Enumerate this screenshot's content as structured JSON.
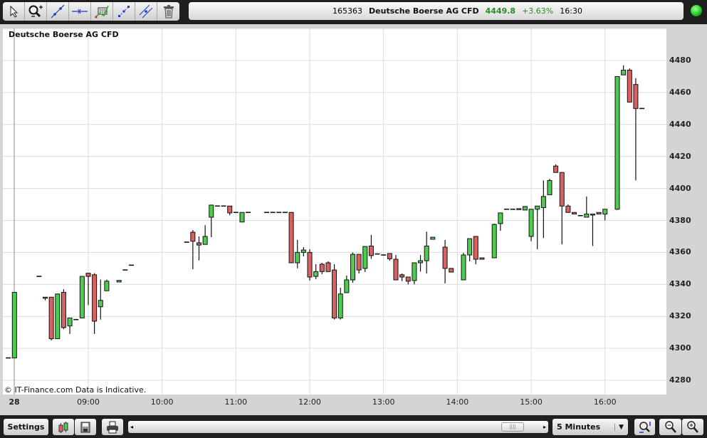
{
  "toolbar": {
    "tools": [
      {
        "name": "pointer-tool",
        "icon": "cursor-icon"
      },
      {
        "name": "zoom-tool",
        "icon": "magnifier-plus-icon"
      },
      {
        "name": "trendline-tool",
        "icon": "trendline-icon"
      },
      {
        "name": "horizontal-line-tool",
        "icon": "horizontal-line-icon"
      },
      {
        "name": "indicator-tool",
        "icon": "indicator-chart-icon"
      },
      {
        "name": "fibonacci-tool",
        "icon": "dotted-line-icon"
      },
      {
        "name": "parallel-channel-tool",
        "icon": "parallel-lines-icon"
      },
      {
        "name": "delete-tool",
        "icon": "trash-icon"
      }
    ]
  },
  "info": {
    "id": "165363",
    "symbol": "Deutsche Boerse AG CFD",
    "price": "4449.8",
    "change": "+3.63%",
    "time": "16:30",
    "status_color": "#33cc33"
  },
  "chart": {
    "title": "Deutsche Boerse AG CFD",
    "copyright": "© IT-Finance.com Data is Indicative."
  },
  "chart_data": {
    "type": "candlestick",
    "title": "Deutsche Boerse AG CFD",
    "interval": "5 Minutes",
    "ylim": [
      4270,
      4500
    ],
    "yticks": [
      "4480",
      "4460",
      "4440",
      "4420",
      "4400",
      "4380",
      "4360",
      "4340",
      "4320",
      "4300",
      "4280"
    ],
    "xticks": [
      "28",
      "09:00",
      "10:00",
      "11:00",
      "12:00",
      "13:00",
      "14:00",
      "15:00",
      "16:00"
    ],
    "colors": {
      "up": "#4fcc4f",
      "down": "#d86262"
    },
    "candles": [
      [
        "07:55",
        4294,
        4294,
        4294,
        4294
      ],
      [
        "08:00",
        4294,
        4335,
        4294,
        4335
      ],
      [
        "08:20",
        4345,
        4345,
        4345,
        4345
      ],
      [
        "08:25",
        4332,
        4332,
        4330,
        4332
      ],
      [
        "08:30",
        4332,
        4332,
        4305,
        4306
      ],
      [
        "08:35",
        4306,
        4334,
        4306,
        4334
      ],
      [
        "08:40",
        4335,
        4337,
        4312,
        4313
      ],
      [
        "08:45",
        4314,
        4319,
        4309,
        4319
      ],
      [
        "08:50",
        4318,
        4318,
        4318,
        4318
      ],
      [
        "08:55",
        4319,
        4345,
        4319,
        4345
      ],
      [
        "09:00",
        4347,
        4347,
        4327,
        4345
      ],
      [
        "09:05",
        4346,
        4347,
        4309,
        4317
      ],
      [
        "09:10",
        4326,
        4343,
        4318,
        4330
      ],
      [
        "09:15",
        4336,
        4343,
        4336,
        4342
      ],
      [
        "09:25",
        4341.5,
        4342.5,
        4341.5,
        4342.5
      ],
      [
        "09:30",
        4349,
        4349,
        4349,
        4349
      ],
      [
        "09:35",
        4352,
        4352,
        4352,
        4352
      ],
      [
        "10:20",
        4366.4,
        4366.4,
        4366.4,
        4366.4
      ],
      [
        "10:25",
        4372.6,
        4374,
        4349.5,
        4367
      ],
      [
        "10:30",
        4366,
        4370,
        4355,
        4364.6
      ],
      [
        "10:35",
        4365,
        4377,
        4365,
        4370
      ],
      [
        "10:40",
        4382,
        4389.6,
        4369.5,
        4389.6
      ],
      [
        "10:45",
        4389,
        4389,
        4389,
        4389
      ],
      [
        "10:50",
        4389,
        4389,
        4389,
        4389
      ],
      [
        "10:55",
        4389,
        4389,
        4383.3,
        4384.7
      ],
      [
        "11:00",
        4385,
        4385,
        4385,
        4385
      ],
      [
        "11:05",
        4379,
        4385,
        4379,
        4385
      ],
      [
        "11:10",
        4385,
        4385,
        4385,
        4385
      ],
      [
        "11:25",
        4385,
        4385,
        4385,
        4385
      ],
      [
        "11:30",
        4385,
        4385,
        4385,
        4385
      ],
      [
        "11:35",
        4385,
        4385,
        4385,
        4385
      ],
      [
        "11:40",
        4385,
        4385,
        4385,
        4385
      ],
      [
        "11:45",
        4385,
        4385,
        4353.5,
        4353.5
      ],
      [
        "11:50",
        4353.5,
        4367.8,
        4350,
        4360
      ],
      [
        "11:55",
        4360,
        4363.3,
        4357.5,
        4361.5
      ],
      [
        "12:00",
        4360,
        4362,
        4342.4,
        4344.6
      ],
      [
        "12:05",
        4345,
        4352.6,
        4343.3,
        4348
      ],
      [
        "12:10",
        4352.6,
        4353.5,
        4346.4,
        4348
      ],
      [
        "12:15",
        4353.5,
        4354.4,
        4348,
        4348
      ],
      [
        "12:20",
        4349,
        4352.6,
        4318,
        4319
      ],
      [
        "12:25",
        4319,
        4337.9,
        4318,
        4334
      ],
      [
        "12:30",
        4334.8,
        4345.5,
        4334.8,
        4342.8
      ],
      [
        "12:35",
        4342.8,
        4360,
        4341,
        4358.8
      ],
      [
        "12:40",
        4358.8,
        4358.8,
        4346.8,
        4349
      ],
      [
        "12:45",
        4350,
        4363.7,
        4347.7,
        4363.7
      ],
      [
        "12:50",
        4364,
        4370.9,
        4356,
        4358
      ],
      [
        "12:55",
        4359,
        4359,
        4359,
        4359
      ],
      [
        "13:00",
        4358.4,
        4358.4,
        4358.4,
        4358.4
      ],
      [
        "13:05",
        4359.3,
        4359.3,
        4354.8,
        4356
      ],
      [
        "13:10",
        4355.7,
        4358.4,
        4342.8,
        4342.8
      ],
      [
        "13:15",
        4346,
        4346.8,
        4342,
        4344.6
      ],
      [
        "13:20",
        4344.6,
        4344.6,
        4340,
        4342
      ],
      [
        "13:25",
        4342.4,
        4353.5,
        4340,
        4353.5
      ],
      [
        "13:30",
        4353.5,
        4358.4,
        4348,
        4354.8
      ],
      [
        "13:35",
        4354.8,
        4373,
        4346.8,
        4364
      ],
      [
        "13:40",
        4368.2,
        4369.5,
        4368.2,
        4369.5
      ],
      [
        "13:50",
        4363.3,
        4367.8,
        4340.6,
        4350
      ],
      [
        "13:55",
        4350,
        4350,
        4347.7,
        4347.7
      ],
      [
        "14:05",
        4342.8,
        4359.7,
        4342.8,
        4358.4
      ],
      [
        "14:10",
        4358.4,
        4368.6,
        4354.4,
        4368.6
      ],
      [
        "14:15",
        4370,
        4370,
        4352.6,
        4355.7
      ],
      [
        "14:20",
        4356.6,
        4356.6,
        4355.7,
        4355.7
      ],
      [
        "14:30",
        4356.6,
        4378,
        4356.6,
        4377.5
      ],
      [
        "14:35",
        4378,
        4384.7,
        4373.5,
        4384.7
      ],
      [
        "14:40",
        4387,
        4387,
        4387,
        4387
      ],
      [
        "14:45",
        4387,
        4387,
        4387,
        4387
      ],
      [
        "14:50",
        4387,
        4387.4,
        4387,
        4387.4
      ],
      [
        "14:55",
        4386.5,
        4388.7,
        4386.5,
        4388.7
      ],
      [
        "15:00",
        4370,
        4387,
        4367,
        4387
      ],
      [
        "15:05",
        4387,
        4389,
        4362,
        4389
      ],
      [
        "15:10",
        4388,
        4405,
        4369,
        4395
      ],
      [
        "15:15",
        4396,
        4406,
        4396,
        4405
      ],
      [
        "15:20",
        4414,
        4415,
        4410,
        4410
      ],
      [
        "15:25",
        4410,
        4410,
        4365,
        4389
      ],
      [
        "15:30",
        4389,
        4390,
        4385,
        4385
      ],
      [
        "15:35",
        4385,
        4385,
        4384,
        4384
      ],
      [
        "15:40",
        4383,
        4383,
        4383,
        4383
      ],
      [
        "15:45",
        4382,
        4395,
        4382,
        4384
      ],
      [
        "15:50",
        4384,
        4384,
        4364,
        4384
      ],
      [
        "15:55",
        4385,
        4385,
        4384,
        4384
      ],
      [
        "16:00",
        4384,
        4387,
        4380,
        4387
      ],
      [
        "16:10",
        4387,
        4470,
        4386.5,
        4470
      ],
      [
        "16:15",
        4471,
        4477,
        4471,
        4474
      ],
      [
        "16:20",
        4474,
        4475,
        4454,
        4454
      ],
      [
        "16:25",
        4465,
        4469,
        4405,
        4450
      ],
      [
        "16:30",
        4450,
        4450,
        4450,
        4450
      ]
    ]
  },
  "bottom": {
    "settings_label": "Settings",
    "interval_label": "5 Minutes",
    "scroll_position": 0.9
  }
}
